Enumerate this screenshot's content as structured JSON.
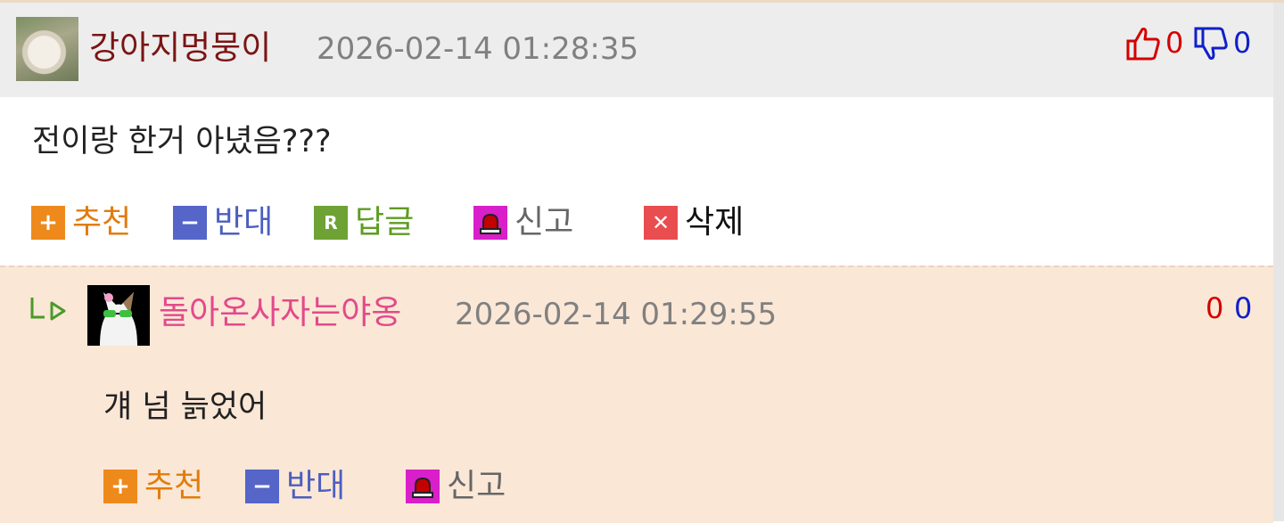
{
  "comments": [
    {
      "nickname": "강아지멍뭉이",
      "datetime": "2026-02-14 01:28:35",
      "upvotes": "0",
      "downvotes": "0",
      "text": "전이랑 한거 아녔음???",
      "actions": {
        "recommend": "추천",
        "oppose": "반대",
        "reply": "답글",
        "report": "신고",
        "delete": "삭제"
      },
      "icons": {
        "recommend": "+",
        "oppose": "−",
        "reply": "R",
        "delete": "✕"
      }
    },
    {
      "nickname": "돌아온사자는야옹",
      "datetime": "2026-02-14 01:29:55",
      "upvotes": "0",
      "downvotes": "0",
      "text": "걔 넘 늙었어",
      "actions": {
        "recommend": "추천",
        "oppose": "반대",
        "report": "신고"
      },
      "icons": {
        "recommend": "+",
        "oppose": "−"
      }
    }
  ],
  "colors": {
    "nickname_main": "#7b1414",
    "nickname_reply": "#e24a8a",
    "upvote": "#d40000",
    "downvote": "#1020c8",
    "reply_background": "#fbe7d6"
  }
}
